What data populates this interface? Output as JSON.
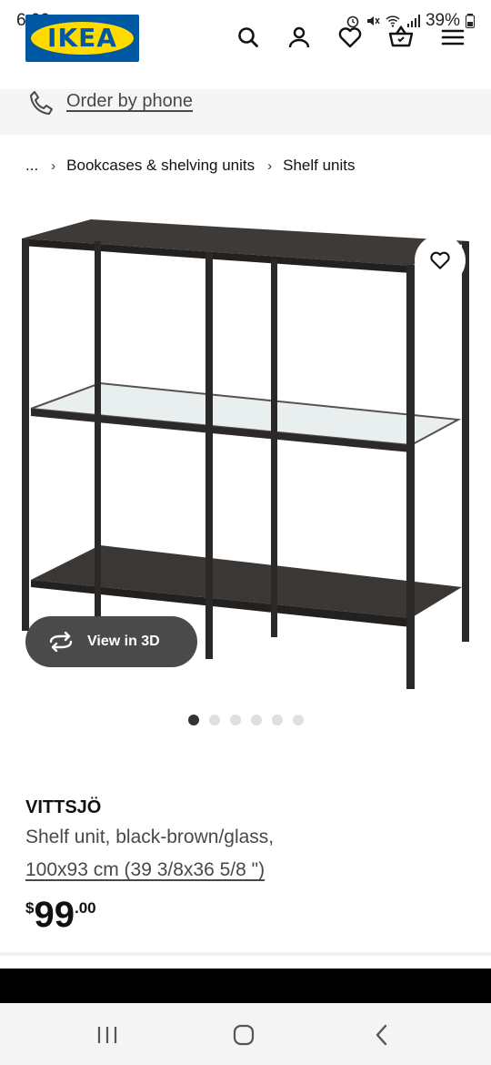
{
  "status_bar": {
    "time": "6:09",
    "battery": "39%"
  },
  "header": {
    "logo_text": "IKEA",
    "icons": [
      "search-icon",
      "user-icon",
      "heart-icon",
      "cart-icon",
      "menu-icon"
    ]
  },
  "phone_strip": {
    "label": "Order by phone"
  },
  "breadcrumb": {
    "items": [
      "...",
      "Bookcases & shelving units",
      "Shelf units"
    ]
  },
  "gallery": {
    "view_3d_label": "View in 3D",
    "total_images": 6,
    "active_index": 0
  },
  "product": {
    "name": "VITTSJÖ",
    "description": "Shelf unit, black-brown/glass,",
    "size": "100x93 cm (39 3/8x36 5/8 \")",
    "price_currency": "$",
    "price_integer": "99",
    "price_decimal": ".00"
  },
  "colors": {
    "brand_blue": "#0058a3",
    "brand_yellow": "#ffdb00",
    "pill_bg": "#4a4a4a"
  }
}
